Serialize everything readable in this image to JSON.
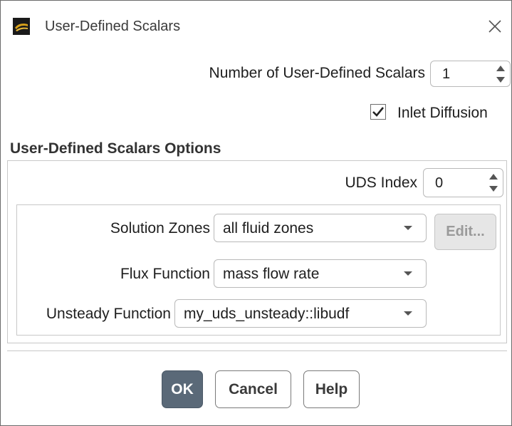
{
  "window": {
    "title": "User-Defined Scalars"
  },
  "number_of_scalars": {
    "label": "Number of User-Defined Scalars",
    "value": "1"
  },
  "inlet_diffusion": {
    "label": "Inlet Diffusion",
    "checked": true
  },
  "options": {
    "section_title": "User-Defined Scalars Options",
    "uds_index": {
      "label": "UDS Index",
      "value": "0"
    },
    "solution_zones": {
      "label": "Solution Zones",
      "value": "all fluid zones"
    },
    "edit_button": "Edit...",
    "flux_function": {
      "label": "Flux Function",
      "value": "mass flow rate"
    },
    "unsteady_function": {
      "label": "Unsteady Function",
      "value": "my_uds_unsteady::libudf"
    }
  },
  "buttons": {
    "ok": "OK",
    "cancel": "Cancel",
    "help": "Help"
  },
  "icons": {
    "app": "app-logo-icon",
    "close": "close-icon",
    "spin_up": "spin-up-icon",
    "spin_down": "spin-down-icon",
    "checkmark": "checkmark-icon",
    "dropdown": "chevron-down-icon"
  },
  "colors": {
    "ok_button_bg": "#5a6978",
    "border": "#b9b9b9",
    "disabled_button_bg": "#e6e6e6"
  }
}
